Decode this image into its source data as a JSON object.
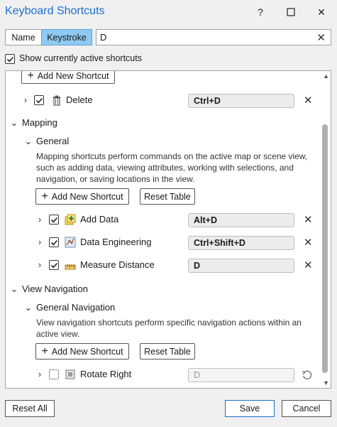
{
  "window": {
    "title": "Keyboard Shortcuts",
    "help": "?",
    "maximize": "☐",
    "close": "✕"
  },
  "search": {
    "mode_name": "Name",
    "mode_keystroke": "Keystroke",
    "active_mode": "Keystroke",
    "value": "D",
    "clear": "✕"
  },
  "show_active": {
    "label": "Show currently active shortcuts",
    "checked": true
  },
  "list": {
    "top_add_label": "Add New Shortcut",
    "delete_item": {
      "label": "Delete",
      "key": "Ctrl+D",
      "checked": true
    },
    "mapping": {
      "label": "Mapping",
      "general": {
        "label": "General",
        "description": "Mapping shortcuts perform commands on the active map or scene view, such as adding data, viewing attributes, working with selections, and navigation, or saving locations in the view.",
        "add_label": "Add New Shortcut",
        "reset_label": "Reset Table",
        "items": [
          {
            "label": "Add Data",
            "key": "Alt+D",
            "checked": true,
            "icon": "add-data-icon"
          },
          {
            "label": "Data Engineering",
            "key": "Ctrl+Shift+D",
            "checked": true,
            "icon": "data-engineering-icon"
          },
          {
            "label": "Measure Distance",
            "key": "D",
            "checked": true,
            "icon": "measure-distance-icon"
          }
        ]
      }
    },
    "view_navigation": {
      "label": "View Navigation",
      "general_navigation": {
        "label": "General Navigation",
        "description": "View navigation shortcuts perform specific navigation actions within an active view.",
        "add_label": "Add New Shortcut",
        "reset_label": "Reset Table",
        "items": [
          {
            "label": "Rotate Right",
            "key": "D",
            "checked": false,
            "icon": "rotate-right-icon",
            "disabled": true
          }
        ]
      }
    }
  },
  "footer": {
    "reset_all": "Reset All",
    "save": "Save",
    "cancel": "Cancel"
  },
  "colors": {
    "title": "#1c6ecc",
    "active_mode": "#8fc9f2",
    "save_border": "#1c6ecc"
  }
}
